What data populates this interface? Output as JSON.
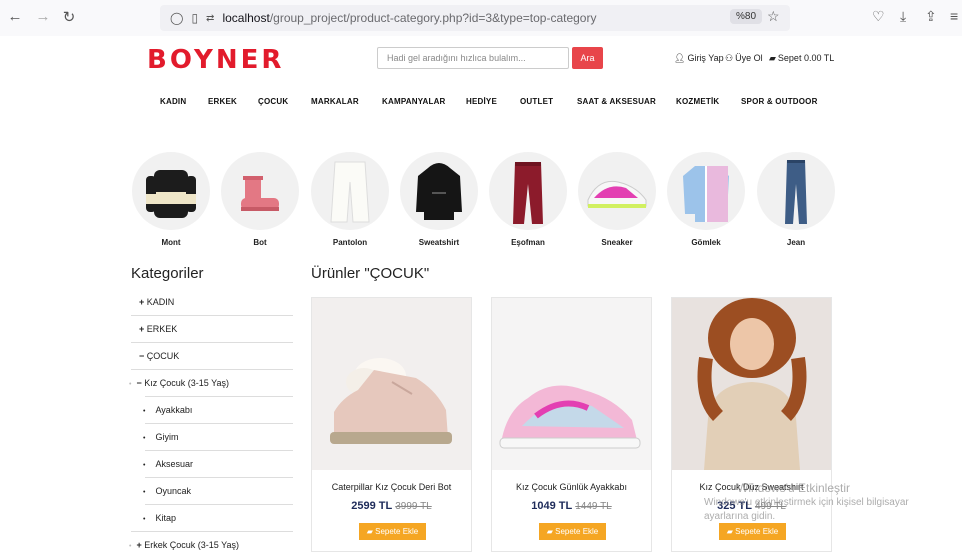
{
  "browser": {
    "url_host": "localhost",
    "url_path": "/group_project/product-category.php?id=3&type=top-category",
    "zoom": "%80"
  },
  "header": {
    "logo": "BOYNER",
    "search_placeholder": "Hadi gel aradığını hızlıca bulalım...",
    "search_button": "Ara",
    "login": "Giriş Yap",
    "register": "Üye Ol",
    "cart": "Sepet 0.00 TL"
  },
  "nav": [
    "KADIN",
    "ERKEK",
    "ÇOCUK",
    "MARKALAR",
    "KAMPANYALAR",
    "HEDİYE",
    "OUTLET",
    "SAAT & AKSESUAR",
    "KOZMETİK",
    "SPOR & OUTDOOR"
  ],
  "categories": [
    {
      "label": "Mont",
      "icon": "jacket-icon"
    },
    {
      "label": "Bot",
      "icon": "boot-icon"
    },
    {
      "label": "Pantolon",
      "icon": "pants-icon"
    },
    {
      "label": "Sweatshirt",
      "icon": "sweatshirt-icon"
    },
    {
      "label": "Eşofman",
      "icon": "tracksuit-icon"
    },
    {
      "label": "Sneaker",
      "icon": "sneaker-icon"
    },
    {
      "label": "Gömlek",
      "icon": "shirt-icon"
    },
    {
      "label": "Jean",
      "icon": "jeans-icon"
    }
  ],
  "sidebar": {
    "title": "Kategoriler",
    "items": [
      {
        "prefix": "+",
        "label": "KADIN"
      },
      {
        "prefix": "+",
        "label": "ERKEK"
      },
      {
        "prefix": "−",
        "label": "ÇOCUK"
      },
      {
        "prefix": "−",
        "label": "Kız Çocuk (3-15 Yaş)"
      },
      {
        "prefix": "",
        "label": "Ayakkabı"
      },
      {
        "prefix": "",
        "label": "Giyim"
      },
      {
        "prefix": "",
        "label": "Aksesuar"
      },
      {
        "prefix": "",
        "label": "Oyuncak"
      },
      {
        "prefix": "",
        "label": "Kitap"
      },
      {
        "prefix": "+",
        "label": "Erkek Çocuk (3-15 Yaş)"
      }
    ]
  },
  "products": {
    "title": "Ürünler \"ÇOCUK\"",
    "cart_button": "Sepete Ekle",
    "items": [
      {
        "name": "Caterpillar Kız Çocuk Deri Bot",
        "price": "2599 TL",
        "old_price": "3999 TL"
      },
      {
        "name": "Kız Çocuk Günlük Ayakkabı",
        "price": "1049 TL",
        "old_price": "1449 TL"
      },
      {
        "name": "Kız Çocuk Düz Sweatshirt",
        "price": "325 TL",
        "old_price": "499 TL"
      }
    ]
  },
  "watermark": {
    "line1": "Windows'u Etkinleştir",
    "line2": "Windows'u etkinleştirmek için kişisel bilgisayar",
    "line3": "ayarlarına gidin."
  }
}
